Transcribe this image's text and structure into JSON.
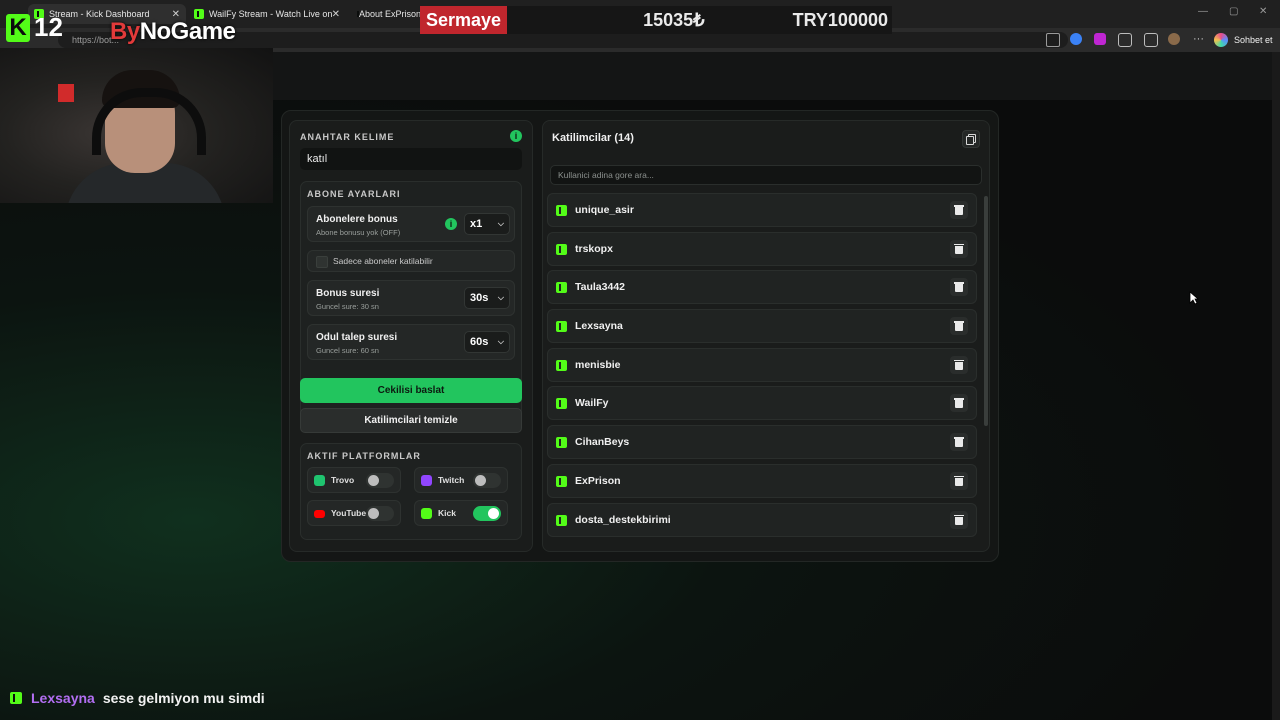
{
  "browser": {
    "tabs": [
      {
        "title": "Stream - Kick Dashboard"
      },
      {
        "title": "WailFy Stream - Watch Live on Kick"
      },
      {
        "title": "About ExPrison"
      }
    ],
    "url": "https://bot...",
    "chat_button": "Sohbet et"
  },
  "overlay": {
    "counter": "12",
    "brand_prefix": "By",
    "brand_main": "NoGame",
    "capital_label": "Sermaye",
    "capital_value": "15035₺",
    "capital_target": "TRY100000"
  },
  "keyword": {
    "title": "ANAHTAR KELIME",
    "value": "katıl"
  },
  "subscriber": {
    "title": "ABONE AYARLARI",
    "bonus_title": "Abonelere bonus",
    "bonus_sub": "Abone bonusu yok (OFF)",
    "bonus_multiplier": "x1",
    "only_subs_label": "Sadece aboneler katilabilir",
    "bonus_duration_title": "Bonus suresi",
    "bonus_duration_sub": "Guncel sure: 30 sn",
    "bonus_duration_value": "30s",
    "reward_title": "Odul talep suresi",
    "reward_sub": "Guncel sure: 60 sn",
    "reward_value": "60s"
  },
  "actions": {
    "start": "Cekilisi baslat",
    "clear": "Katilimcilari temizle"
  },
  "platforms": {
    "title": "AKTIF PLATFORMLAR",
    "items": [
      {
        "name": "Trovo",
        "on": false,
        "color": "#1fc46f"
      },
      {
        "name": "Twitch",
        "on": false,
        "color": "#9146ff"
      },
      {
        "name": "YouTube",
        "on": false,
        "color": "#ff0000"
      },
      {
        "name": "Kick",
        "on": true,
        "color": "#53fc18"
      }
    ]
  },
  "participants": {
    "title": "Katilimcilar (14)",
    "search_placeholder": "Kullanici adina gore ara...",
    "items": [
      "unique_asir",
      "trskopx",
      "Taula3442",
      "Lexsayna",
      "menisbie",
      "WailFy",
      "CihanBeys",
      "ExPrison",
      "dosta_destekbirimi"
    ]
  },
  "chat": {
    "user": "Lexsayna",
    "message": "sese gelmiyon mu simdi"
  },
  "colors": {
    "accent": "#22c55e",
    "kick": "#53fc18"
  }
}
